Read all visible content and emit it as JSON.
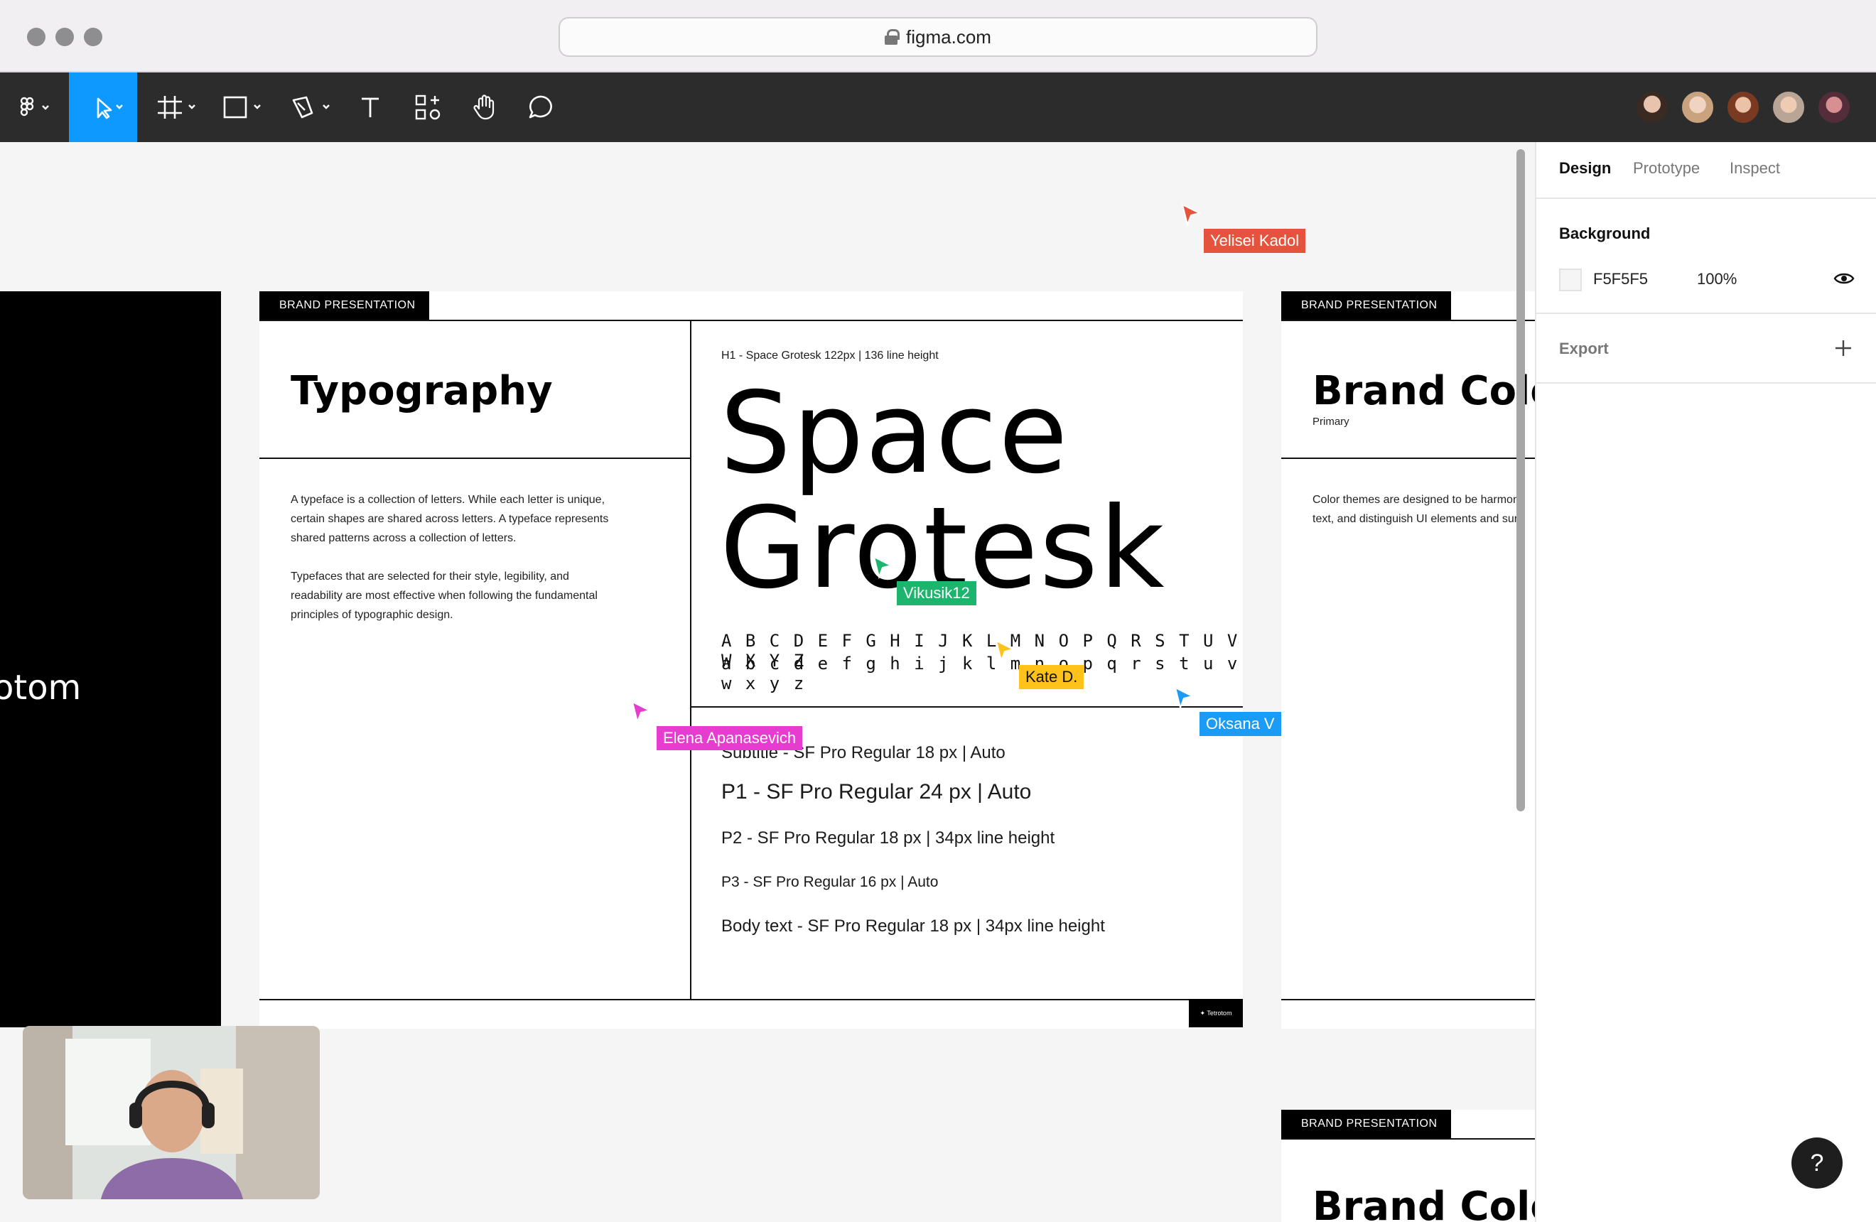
{
  "browser": {
    "url": "figma.com"
  },
  "toolbar": {
    "tools": [
      "main-menu",
      "move",
      "frame",
      "shape",
      "pen",
      "text",
      "resources",
      "hand",
      "comment"
    ]
  },
  "collaborators": [
    "Collaborator 1",
    "Collaborator 2",
    "Collaborator 3",
    "Collaborator 4",
    "Collaborator 5"
  ],
  "canvas": {
    "left_frame_text": "otom",
    "typography_frame": {
      "tab": "BRAND PRESENTATION",
      "title": "Typography",
      "para1_line1": "A typeface is a collection of letters. While each letter is unique,",
      "para1_line2": "certain shapes are shared across letters. A typeface represents",
      "para1_line3": "shared patterns across a collection of letters.",
      "para2_line1": "Typefaces that are selected for their style, legibility, and",
      "para2_line2": "readability are most effective when following the fundamental",
      "para2_line3": "principles of typographic design.",
      "h1_spec": "H1 - Space Grotesk 122px | 136 line height",
      "font_name_line1": "Space",
      "font_name_line2": "Grotesk",
      "uppercase": "A B C D E F G H I J K L M N O P Q R S T U V W X Y Z",
      "lowercase": "a b c d e f g h i j k l m n o p q r s t u v w x y z",
      "subtitle_spec": "Subtitle - SF Pro Regular 18 px | Auto",
      "p1_spec": "P1 - SF Pro Regular 24 px | Auto",
      "p2_spec": "P2 - SF Pro Regular 18 px | 34px line height",
      "p3_spec": "P3 - SF Pro Regular 16 px | Auto",
      "body_spec": "Body text - SF Pro Regular 18 px | 34px line height",
      "logo_badge": "✦ Tetrotom"
    },
    "color_frame": {
      "tab": "BRAND PRESENTATION",
      "title": "Brand Colo",
      "subtitle": "Primary",
      "text_line1": "Color themes are designed to be harmon",
      "text_line2": "text, and distinguish UI elements and sur"
    },
    "color_frame_2": {
      "tab": "BRAND PRESENTATION",
      "title": "Brand Colo"
    },
    "cursors": [
      {
        "name": "Yelisei Kadol",
        "color": "#e5533d"
      },
      {
        "name": "Vikusik12",
        "color": "#1db56e"
      },
      {
        "name": "Kate D.",
        "color": "#ffc21a"
      },
      {
        "name": "Oksana V",
        "color": "#1a9bf5"
      },
      {
        "name": "Elena Apanasevich",
        "color": "#e63ccf"
      }
    ]
  },
  "panel": {
    "tabs": [
      "Design",
      "Prototype",
      "Inspect"
    ],
    "background_label": "Background",
    "background_hex": "F5F5F5",
    "background_opacity": "100%",
    "export_label": "Export",
    "help": "?"
  }
}
